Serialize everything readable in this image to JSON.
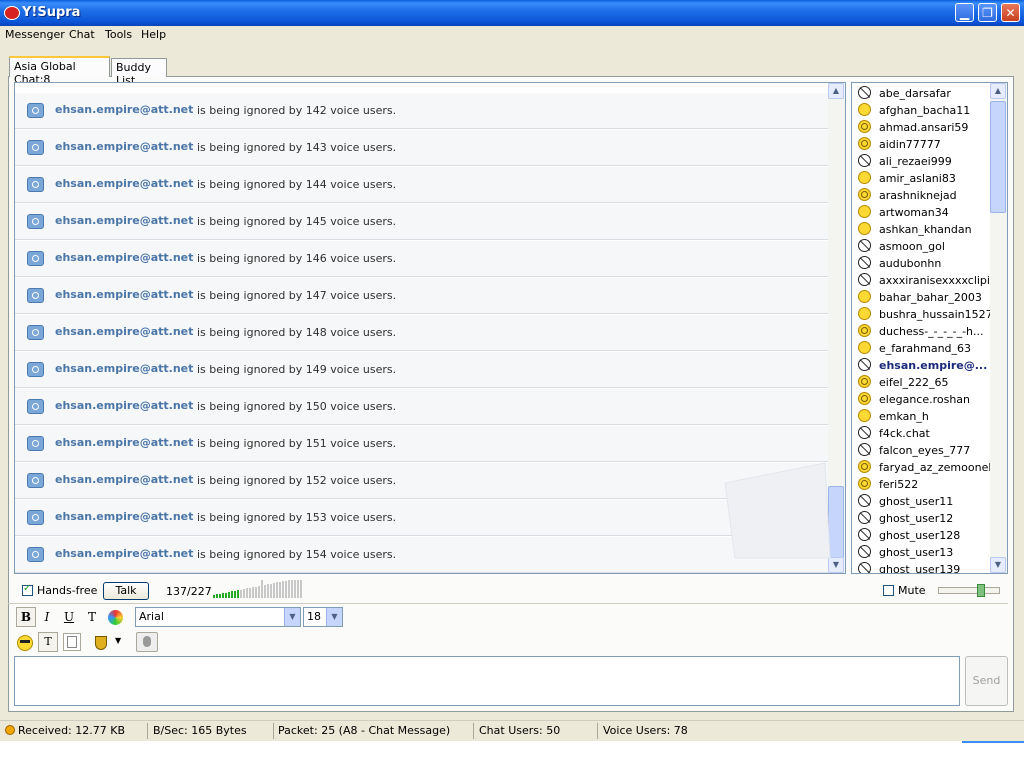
{
  "window": {
    "title": "Y!Supra"
  },
  "menu": [
    "Messenger",
    "Chat",
    "Tools",
    "Help"
  ],
  "tabs": [
    {
      "label": "Asia Global Chat:8",
      "active": true
    },
    {
      "label": "Buddy List",
      "active": false
    }
  ],
  "chat": {
    "messages": [
      {
        "user": "ehsan.empire@att.net",
        "text": "is being ignored by 142 voice users."
      },
      {
        "user": "ehsan.empire@att.net",
        "text": "is being ignored by 143 voice users."
      },
      {
        "user": "ehsan.empire@att.net",
        "text": "is being ignored by 144 voice users."
      },
      {
        "user": "ehsan.empire@att.net",
        "text": "is being ignored by 145 voice users."
      },
      {
        "user": "ehsan.empire@att.net",
        "text": "is being ignored by 146 voice users."
      },
      {
        "user": "ehsan.empire@att.net",
        "text": "is being ignored by 147 voice users."
      },
      {
        "user": "ehsan.empire@att.net",
        "text": "is being ignored by 148 voice users."
      },
      {
        "user": "ehsan.empire@att.net",
        "text": "is being ignored by 149 voice users."
      },
      {
        "user": "ehsan.empire@att.net",
        "text": "is being ignored by 150 voice users."
      },
      {
        "user": "ehsan.empire@att.net",
        "text": "is being ignored by 151 voice users."
      },
      {
        "user": "ehsan.empire@att.net",
        "text": "is being ignored by 152 voice users."
      },
      {
        "user": "ehsan.empire@att.net",
        "text": "is being ignored by 153 voice users."
      },
      {
        "user": "ehsan.empire@att.net",
        "text": "is being ignored by 154 voice users."
      }
    ]
  },
  "users": [
    {
      "name": "abe_darsafar",
      "icon": "muted-icon"
    },
    {
      "name": "afghan_bacha11",
      "icon": "smile-icon"
    },
    {
      "name": "ahmad.ansari59",
      "icon": "voice-smile-icon"
    },
    {
      "name": "aidin77777",
      "icon": "voice-smile-icon"
    },
    {
      "name": "ali_rezaei999",
      "icon": "muted-icon"
    },
    {
      "name": "amir_aslani83",
      "icon": "smile-icon"
    },
    {
      "name": "arashniknejad",
      "icon": "voice-smile-icon"
    },
    {
      "name": "artwoman34",
      "icon": "smile-icon"
    },
    {
      "name": "ashkan_khandan",
      "icon": "smile-icon"
    },
    {
      "name": "asmoon_gol",
      "icon": "muted-icon"
    },
    {
      "name": "audubonhn",
      "icon": "muted-icon"
    },
    {
      "name": "axxxiranisexxxxclipir...",
      "icon": "muted-icon"
    },
    {
      "name": "bahar_bahar_2003",
      "icon": "smile-icon"
    },
    {
      "name": "bushra_hussain1527",
      "icon": "smile-icon"
    },
    {
      "name": "duchess-_-_-_-_-h...",
      "icon": "voice-smile-icon"
    },
    {
      "name": "e_farahmand_63",
      "icon": "smile-icon"
    },
    {
      "name": "ehsan.empire@...",
      "icon": "muted-icon",
      "bold": true
    },
    {
      "name": "eifel_222_65",
      "icon": "voice-smile-icon"
    },
    {
      "name": "elegance.roshan",
      "icon": "voice-smile-icon"
    },
    {
      "name": "emkan_h",
      "icon": "smile-icon"
    },
    {
      "name": "f4ck.chat",
      "icon": "muted-icon"
    },
    {
      "name": "falcon_eyes_777",
      "icon": "muted-icon"
    },
    {
      "name": "faryad_az_zemooneh",
      "icon": "voice-smile-icon"
    },
    {
      "name": "feri522",
      "icon": "voice-smile-icon"
    },
    {
      "name": "ghost_user11",
      "icon": "muted-icon"
    },
    {
      "name": "ghost_user12",
      "icon": "muted-icon"
    },
    {
      "name": "ghost_user128",
      "icon": "muted-icon"
    },
    {
      "name": "ghost_user13",
      "icon": "muted-icon"
    },
    {
      "name": "ghost_user139",
      "icon": "muted-icon"
    }
  ],
  "voice": {
    "handsfree_label": "Hands-free",
    "handsfree_checked": true,
    "talk_label": "Talk",
    "counter": "137/227",
    "mute_label": "Mute",
    "mute_checked": false
  },
  "format": {
    "bold": "B",
    "italic": "I",
    "underline": "U",
    "text": "T",
    "font": "Arial",
    "size": "18"
  },
  "compose": {
    "value": "",
    "send_label": "Send"
  },
  "status": {
    "received": "Received: 12.77 KB",
    "bsec": "B/Sec: 165 Bytes",
    "packet": "Packet: 25 (A8 - Chat Message)",
    "chat_users": "Chat Users: 50",
    "voice_users": "Voice Users: 78"
  },
  "colors": {
    "titlebar": "#0a54d6",
    "username": "#4a76a8",
    "tab_accent": "#ffc83c"
  }
}
